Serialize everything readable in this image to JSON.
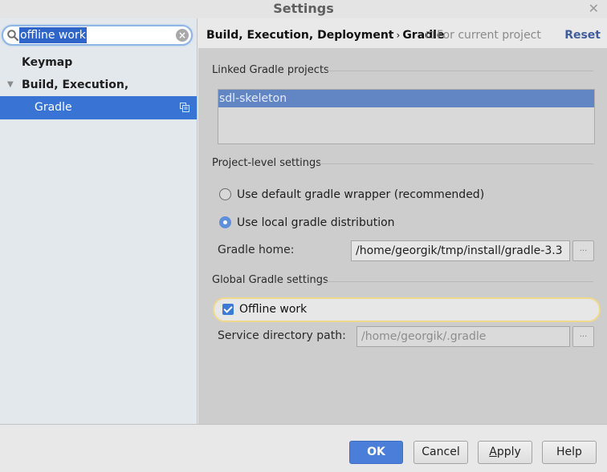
{
  "window": {
    "title": "Settings",
    "close_glyph": "✕"
  },
  "sidebar": {
    "search": {
      "value": "offline work",
      "placeholder": ""
    },
    "items": [
      {
        "label": "Keymap",
        "expanded": null,
        "selected": false
      },
      {
        "label": "Build, Execution, Deployment",
        "expanded": true,
        "selected": false
      },
      {
        "label": "Gradle",
        "expanded": null,
        "selected": true,
        "project_scoped": true
      }
    ],
    "expand_glyph": "▼"
  },
  "header": {
    "breadcrumb": [
      "Build, Execution, Deployment",
      "Gradle"
    ],
    "breadcrumb_separator": "›",
    "scope_label": "For current project",
    "reset_label": "Reset"
  },
  "linked_projects": {
    "title": "Linked Gradle projects",
    "items": [
      {
        "name": "sdl-skeleton",
        "selected": true
      }
    ]
  },
  "project_level": {
    "title": "Project-level settings",
    "options": [
      {
        "label": "Use default gradle wrapper (recommended)",
        "selected": false
      },
      {
        "label": "Use local gradle distribution",
        "selected": true
      }
    ],
    "gradle_home_label": "Gradle home:",
    "gradle_home_value": "/home/georgik/tmp/install/gradle-3.3",
    "browse_label": "..."
  },
  "global": {
    "title": "Global Gradle settings",
    "offline_work_label": "Offline work",
    "offline_work_checked": true,
    "service_dir_label": "Service directory path:",
    "service_dir_value": "/home/georgik/.gradle",
    "browse_label": "..."
  },
  "footer": {
    "ok_label": "OK",
    "cancel_label": "Cancel",
    "apply_mnemonic": "A",
    "apply_rest": "pply",
    "help_label": "Help"
  },
  "colors": {
    "accent": "#3974d5",
    "list_selection": "#6285c3",
    "highlight_border": "#f0d98a",
    "reset_link": "#3f5d9b"
  }
}
